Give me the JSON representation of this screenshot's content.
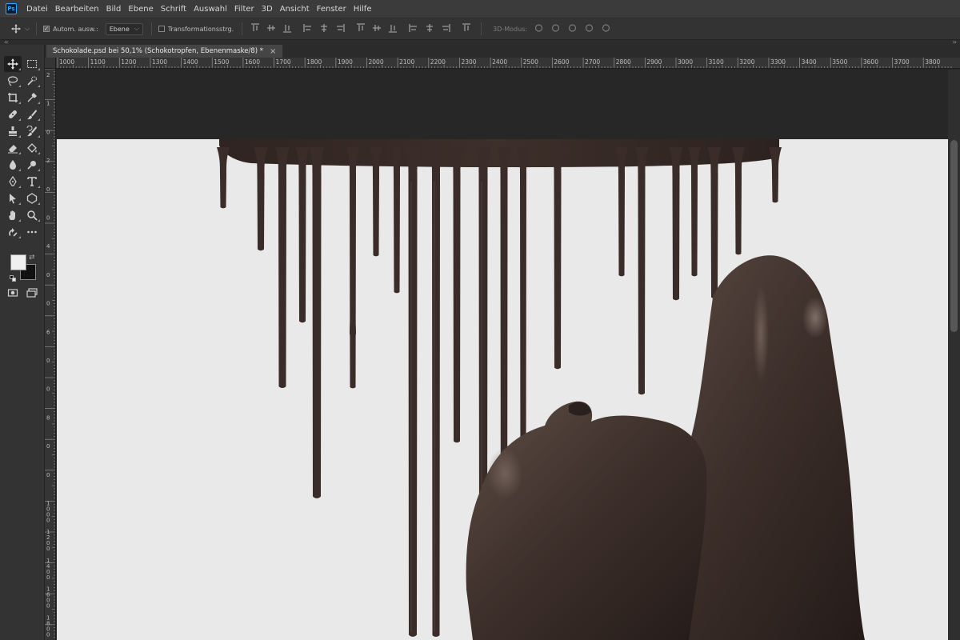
{
  "app": {
    "logo_text": "Ps"
  },
  "menu": [
    "Datei",
    "Bearbeiten",
    "Bild",
    "Ebene",
    "Schrift",
    "Auswahl",
    "Filter",
    "3D",
    "Ansicht",
    "Fenster",
    "Hilfe"
  ],
  "options": {
    "auto_select_label": "Autom. ausw.:",
    "auto_select_checked": true,
    "layer_select_value": "Ebene",
    "transform_label": "Transformationsstrg.",
    "transform_checked": false,
    "mode_3d_label": "3D-Modus:"
  },
  "document": {
    "tab_title": "Schokolade.psd bei 50,1% (Schokotropfen, Ebenenmaske/8) *",
    "close_glyph": "×"
  },
  "ruler_h_labels": [
    "1000",
    "1100",
    "1200",
    "1300",
    "1400",
    "1500",
    "1600",
    "1700",
    "1800",
    "1900",
    "2000",
    "2100",
    "2200",
    "2300",
    "2400",
    "2500",
    "2600",
    "2700",
    "2800",
    "2900",
    "3000",
    "3100",
    "3200",
    "3300",
    "3400",
    "3500",
    "3600",
    "3700",
    "3800"
  ],
  "ruler_v_labels": [
    "2",
    "1",
    "0",
    "2",
    "0",
    "0",
    "4",
    "0",
    "0",
    "6",
    "0",
    "0",
    "8",
    "0",
    "0",
    "1000",
    "1200",
    "1400",
    "1600",
    "1800"
  ],
  "tools": [
    "move-tool",
    "marquee-tool",
    "lasso-tool",
    "quick-selection-tool",
    "crop-tool",
    "eyedropper-tool",
    "healing-brush-tool",
    "brush-tool",
    "clone-stamp-tool",
    "history-brush-tool",
    "eraser-tool",
    "paint-bucket-tool",
    "blur-tool",
    "dodge-tool",
    "pen-tool",
    "type-tool",
    "path-selection-tool",
    "shape-tool",
    "hand-tool",
    "zoom-tool",
    "rotate-view-tool",
    "more-tools"
  ],
  "colors": {
    "foreground": "#f0f0f0",
    "background": "#111111",
    "canvas_backdrop": "#272727",
    "paper": "#e9e9e9",
    "chocolate": "#3a2c28",
    "chocolate_highlight": "#6b5a52"
  }
}
